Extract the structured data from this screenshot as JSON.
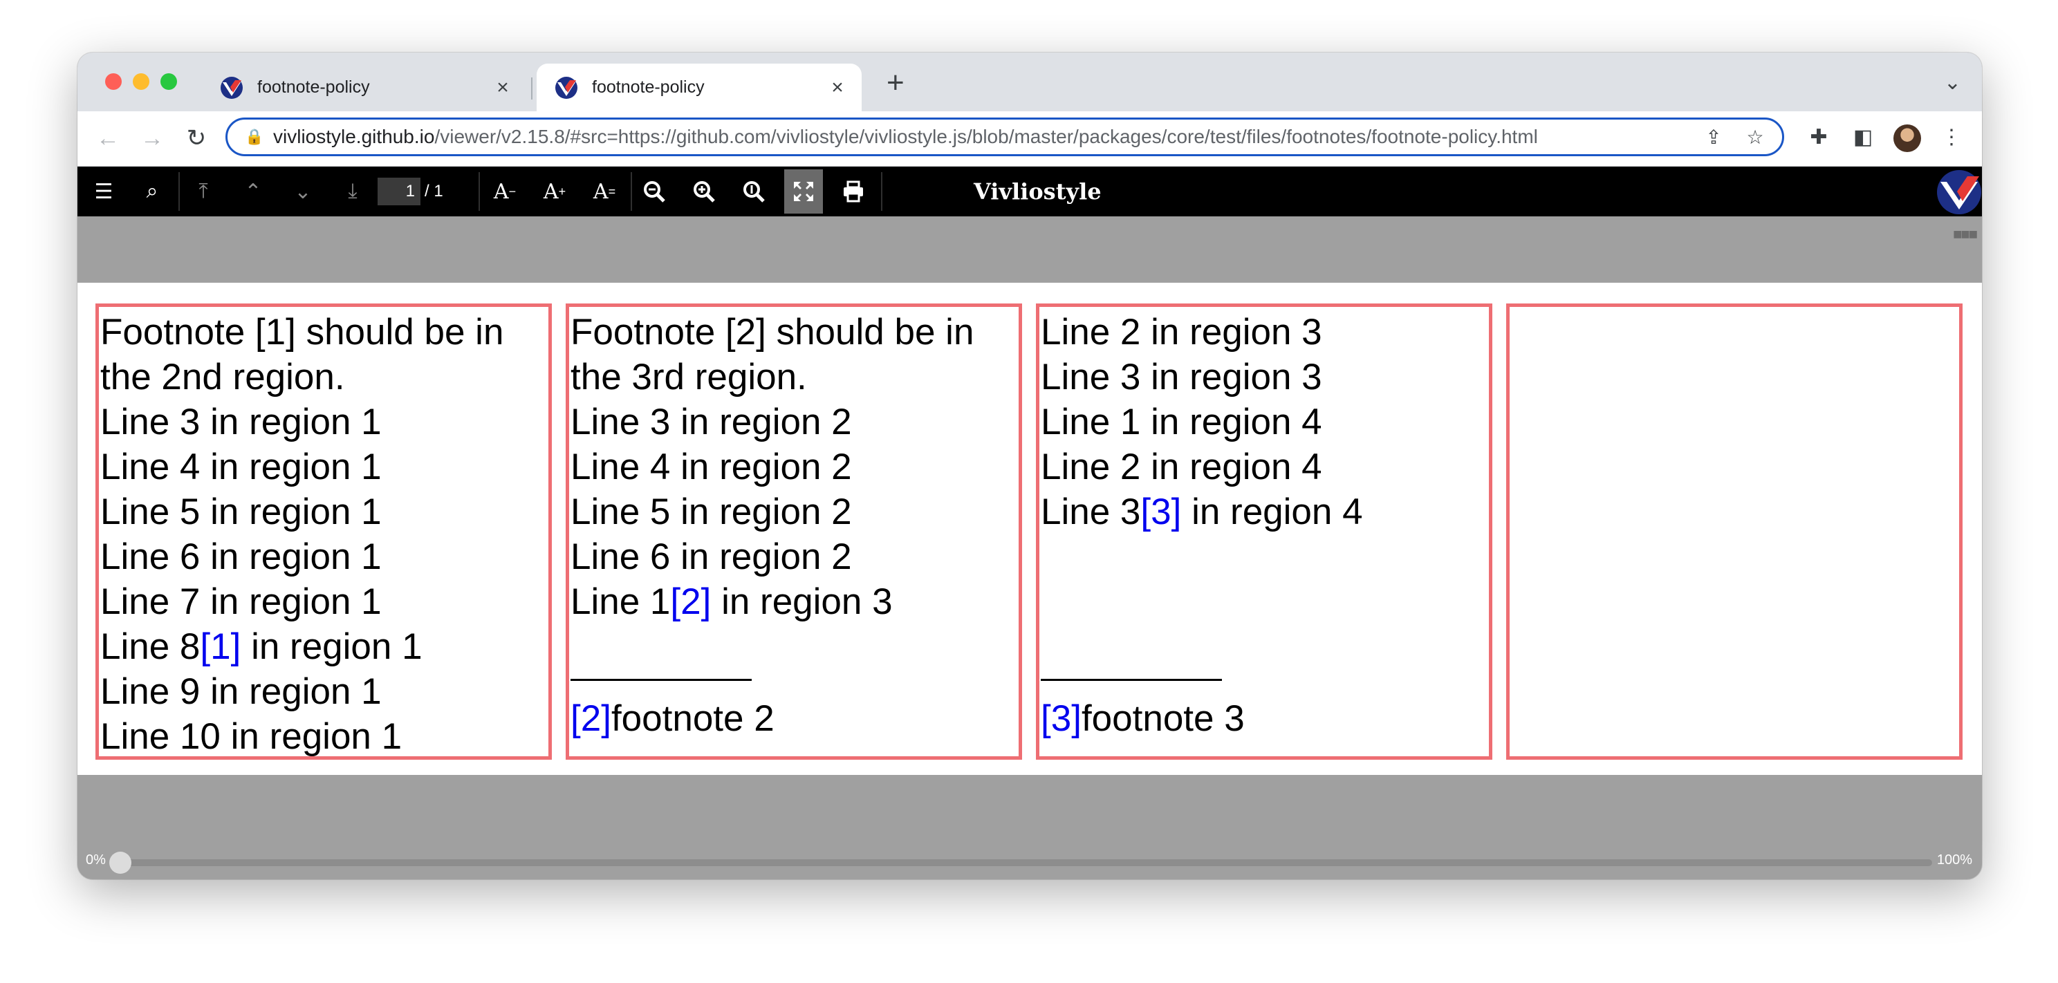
{
  "browser": {
    "tabs": [
      {
        "title": "footnote-policy",
        "close": "×"
      },
      {
        "title": "footnote-policy",
        "close": "×"
      }
    ],
    "new_tab": "+",
    "tab_menu": "⌄",
    "nav": {
      "back": "←",
      "forward": "→",
      "reload": "↻"
    },
    "url": {
      "lock": "🔒",
      "host": "vivliostyle.github.io",
      "path": "/viewer/v2.15.8/#src=https://github.com/vivliostyle/vivliostyle.js/blob/master/packages/core/test/files/footnotes/footnote-policy.html"
    },
    "icons": {
      "share": "⇪",
      "bookmark": "☆",
      "extensions": "✚",
      "side_panel": "◧",
      "menu": "⋮"
    }
  },
  "viewer": {
    "buttons": {
      "toc": "☰",
      "search": "⌕",
      "first_page": "⤒",
      "prev_page": "⌃",
      "next_page": "⌄",
      "last_page": "⤓",
      "font_size_down": {
        "glyph": "A",
        "mark": "−"
      },
      "font_size_up": {
        "glyph": "A",
        "mark": "+"
      },
      "font_size_reset": {
        "glyph": "A",
        "mark": "="
      },
      "zoom_out": "−",
      "zoom_in": "+",
      "zoom_actual": "1",
      "fit_page": "⤢",
      "print": "⎙"
    },
    "page": {
      "current": "1",
      "total": "/ 1"
    },
    "brand": "Vivliostyle",
    "grip": "■■■"
  },
  "document": {
    "regions": [
      {
        "lines": [
          {
            "text": "Footnote [1] should be in"
          },
          {
            "text": "the 2nd region."
          },
          {
            "text": "Line 3 in region 1"
          },
          {
            "text": "Line 4 in region 1"
          },
          {
            "text": "Line 5 in region 1"
          },
          {
            "text": "Line 6 in region 1"
          },
          {
            "text": "Line 7 in region 1"
          },
          {
            "before": "Line 8",
            "ref": "[1]",
            "after": " in region 1"
          },
          {
            "text": "Line 9 in region 1"
          },
          {
            "text": "Line 10 in region 1"
          }
        ]
      },
      {
        "lines": [
          {
            "text": "Footnote [2] should be in"
          },
          {
            "text": "the 3rd region."
          },
          {
            "text": "Line 3 in region 2"
          },
          {
            "text": "Line 4 in region 2"
          },
          {
            "text": "Line 5 in region 2"
          },
          {
            "text": "Line 6 in region 2"
          },
          {
            "before": "Line 1",
            "ref": "[2]",
            "after": " in region 3"
          }
        ],
        "footnote": {
          "ref": "[2]",
          "text": "footnote 2"
        }
      },
      {
        "lines": [
          {
            "text": "Line 2 in region 3"
          },
          {
            "text": "Line 3 in region 3"
          },
          {
            "text": "Line 1 in region 4"
          },
          {
            "text": "Line 2 in region 4"
          },
          {
            "before": "Line 3",
            "ref": "[3]",
            "after": " in region 4"
          }
        ],
        "footnote": {
          "ref": "[3]",
          "text": "footnote 3"
        }
      },
      {
        "lines": []
      }
    ]
  },
  "progress": {
    "start_label": "0%",
    "end_label": "100%",
    "value": 0
  },
  "colors": {
    "region_border": "#ee6e73",
    "footnote_ref": "#0000ee",
    "omnibox_focus": "#1a56c6"
  }
}
